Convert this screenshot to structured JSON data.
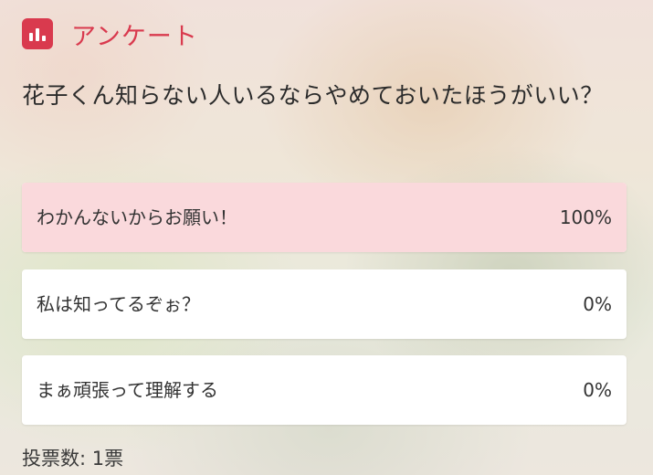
{
  "header": {
    "icon": "bar-chart-icon",
    "title": "アンケート",
    "accent_color": "#d93a4e"
  },
  "question": "花子くん知らない人いるならやめておいたほうがいい？",
  "options": [
    {
      "label": "わかんないからお願い！",
      "percent": "100%",
      "fill_fraction": 1.0
    },
    {
      "label": "私は知ってるぞぉ？",
      "percent": "0%",
      "fill_fraction": 0.0
    },
    {
      "label": "まぁ頑張って理解する",
      "percent": "0%",
      "fill_fraction": 0.0
    }
  ],
  "votes": "投票数: 1票"
}
